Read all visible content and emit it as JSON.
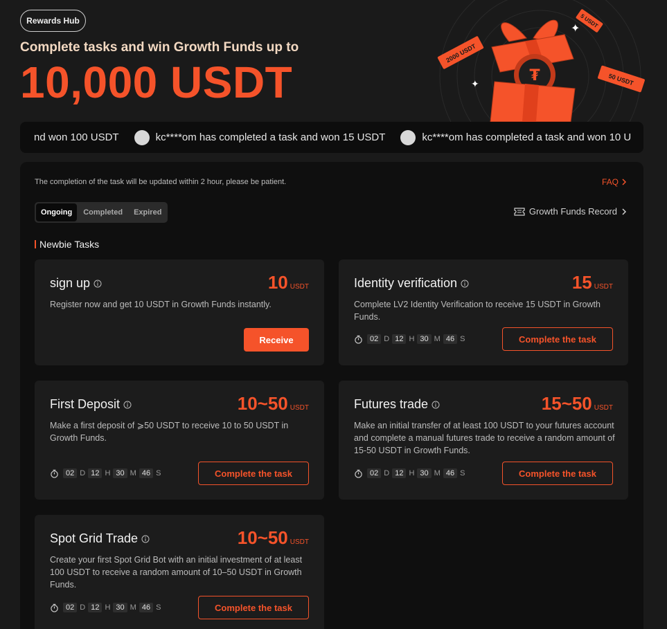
{
  "hero": {
    "badge": "Rewards Hub",
    "subtitle": "Complete tasks and win Growth Funds up to",
    "amount": "10,000 USDT",
    "tickets": [
      "2000 USDT",
      "5 USDT",
      "50 USDT"
    ]
  },
  "ticker": {
    "items": [
      {
        "text": "nd won 100 USDT",
        "avatar": false
      },
      {
        "text": "kc****om has completed a task and won 15 USDT",
        "avatar": true
      },
      {
        "text": "kc****om has completed a task and won 10 U",
        "avatar": true
      }
    ]
  },
  "panel": {
    "notice": "The completion of the task will be updated within 2 hour, please be patient.",
    "faq": "FAQ",
    "tabs": [
      "Ongoing",
      "Completed",
      "Expired"
    ],
    "active_tab": "Ongoing",
    "record": "Growth Funds Record",
    "section_title": "Newbie Tasks"
  },
  "tasks": [
    {
      "title": "sign up",
      "reward": "10",
      "unit": "USDT",
      "desc": "Register now and get 10 USDT in Growth Funds instantly.",
      "button": "Receive"
    },
    {
      "title": "Identity verification",
      "reward": "15",
      "unit": "USDT",
      "desc": "Complete LV2 Identity Verification to receive 15 USDT in Growth Funds.",
      "button": "Complete the task",
      "countdown": {
        "d": "02",
        "h": "12",
        "m": "30",
        "s": "46"
      }
    },
    {
      "title": "First Deposit",
      "reward": "10~50",
      "unit": "USDT",
      "desc": "Make a first deposit of ⩾50 USDT to receive 10 to 50 USDT in Growth Funds.",
      "button": "Complete the task",
      "countdown": {
        "d": "02",
        "h": "12",
        "m": "30",
        "s": "46"
      }
    },
    {
      "title": "Futures trade",
      "reward": "15~50",
      "unit": "USDT",
      "desc": "Make an initial transfer of at least 100 USDT to your futures account and complete a manual futures trade to receive a random amount of 15-50 USDT in Growth Funds.",
      "button": "Complete the task",
      "countdown": {
        "d": "02",
        "h": "12",
        "m": "30",
        "s": "46"
      }
    },
    {
      "title": "Spot Grid Trade",
      "reward": "10~50",
      "unit": "USDT",
      "desc": "Create your first Spot Grid Bot with an initial investment of at least 100 USDT to receive a random amount of 10–50 USDT in Growth Funds.",
      "button": "Complete the task",
      "countdown": {
        "d": "02",
        "h": "12",
        "m": "30",
        "s": "46"
      }
    }
  ],
  "countdown_units": {
    "d": "D",
    "h": "H",
    "m": "M",
    "s": "S"
  },
  "colors": {
    "accent": "#f5532a",
    "background": "#1a1a1a",
    "panel": "#0f0f0f",
    "card": "#1c1c1c"
  }
}
